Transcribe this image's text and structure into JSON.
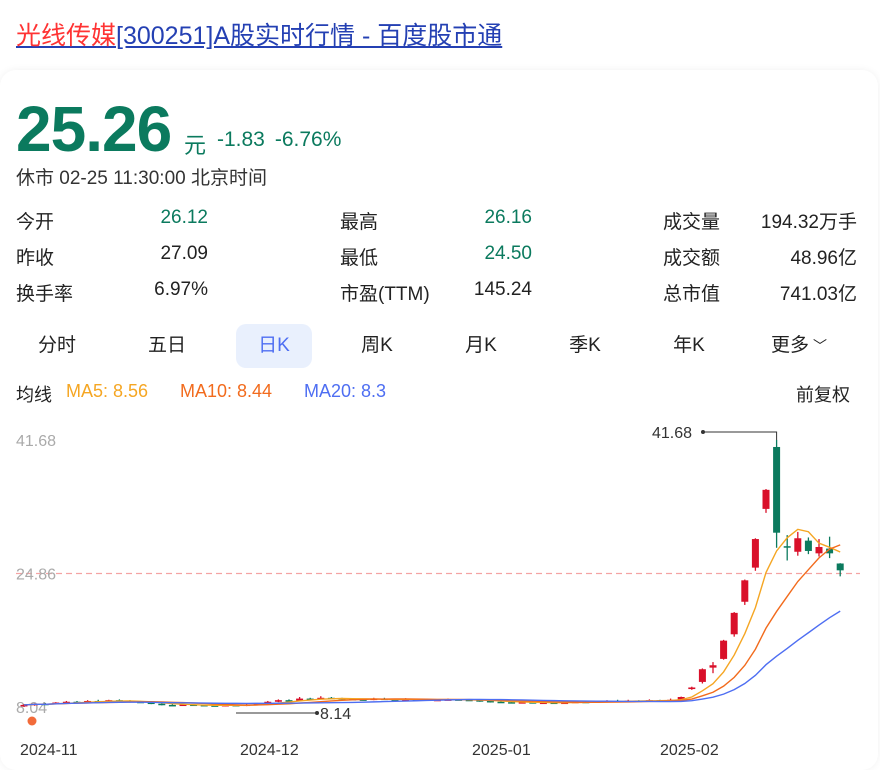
{
  "title": {
    "name": "光线传媒",
    "rest": "[300251]A股实时行情 - 百度股市通"
  },
  "quote": {
    "price": "25.26",
    "unit": "元",
    "change": "-1.83",
    "change_pct": "-6.76%",
    "status": "休市 02-25 11:30:00 北京时间"
  },
  "stats": [
    {
      "label": "今开",
      "value": "26.12",
      "green": true
    },
    {
      "label": "最高",
      "value": "26.16",
      "green": true
    },
    {
      "label": "成交量",
      "value": "194.32万手"
    },
    {
      "label": "昨收",
      "value": "27.09"
    },
    {
      "label": "最低",
      "value": "24.50",
      "green": true
    },
    {
      "label": "成交额",
      "value": "48.96亿"
    },
    {
      "label": "换手率",
      "value": "6.97%"
    },
    {
      "label": "市盈(TTM)",
      "value": "145.24"
    },
    {
      "label": "总市值",
      "value": "741.03亿"
    }
  ],
  "tabs": [
    {
      "label": "分时"
    },
    {
      "label": "五日"
    },
    {
      "label": "日K",
      "selected": true
    },
    {
      "label": "周K"
    },
    {
      "label": "月K"
    },
    {
      "label": "季K"
    },
    {
      "label": "年K"
    },
    {
      "label": "更多"
    }
  ],
  "legend": {
    "label": "均线",
    "ma5": "MA5: 8.56",
    "ma10": "MA10: 8.44",
    "ma20": "MA20: 8.3",
    "adjust": "前复权"
  },
  "colors": {
    "up": "#d9102a",
    "down": "#0b7a5e",
    "ma5": "#f5a623",
    "ma10": "#f26b1d",
    "ma20": "#4e6ef2",
    "link": "#2440b3",
    "accent": "#4e6ef2"
  },
  "chart_data": {
    "type": "candlestick",
    "y_ticks": [
      "41.68",
      "24.86",
      "8.04"
    ],
    "ref_line": 24.86,
    "max_label": "41.68",
    "min_label": "8.14",
    "x_labels": [
      "2024-11",
      "2024-12",
      "2025-01",
      "2025-02"
    ],
    "ylim": [
      8.04,
      41.68
    ],
    "ohlc_fields": [
      "open",
      "close",
      "high",
      "low"
    ],
    "candles": [
      [
        8.2,
        8.3,
        8.4,
        8.04
      ],
      [
        8.3,
        8.45,
        8.5,
        8.2
      ],
      [
        8.45,
        8.4,
        8.55,
        8.3
      ],
      [
        8.4,
        8.6,
        8.65,
        8.35
      ],
      [
        8.6,
        8.7,
        8.8,
        8.5
      ],
      [
        8.7,
        8.65,
        8.8,
        8.55
      ],
      [
        8.65,
        8.8,
        8.9,
        8.6
      ],
      [
        8.8,
        8.75,
        8.95,
        8.7
      ],
      [
        8.75,
        8.9,
        8.95,
        8.7
      ],
      [
        8.9,
        8.85,
        9.0,
        8.75
      ],
      [
        8.85,
        8.7,
        8.9,
        8.6
      ],
      [
        8.7,
        8.6,
        8.8,
        8.55
      ],
      [
        8.6,
        8.45,
        8.65,
        8.4
      ],
      [
        8.45,
        8.3,
        8.5,
        8.25
      ],
      [
        8.3,
        8.25,
        8.4,
        8.2
      ],
      [
        8.25,
        8.35,
        8.4,
        8.2
      ],
      [
        8.35,
        8.3,
        8.4,
        8.25
      ],
      [
        8.3,
        8.25,
        8.35,
        8.2
      ],
      [
        8.25,
        8.15,
        8.3,
        8.14
      ],
      [
        8.15,
        8.3,
        8.35,
        8.14
      ],
      [
        8.3,
        8.2,
        8.35,
        8.15
      ],
      [
        8.2,
        8.35,
        8.5,
        8.15
      ],
      [
        8.35,
        8.5,
        8.55,
        8.3
      ],
      [
        8.5,
        8.7,
        8.8,
        8.45
      ],
      [
        8.7,
        8.9,
        9.0,
        8.65
      ],
      [
        8.9,
        8.85,
        9.0,
        8.8
      ],
      [
        8.85,
        9.1,
        9.3,
        8.8
      ],
      [
        9.1,
        9.05,
        9.2,
        8.95
      ],
      [
        9.05,
        9.2,
        9.4,
        9.0
      ],
      [
        9.2,
        9.15,
        9.3,
        9.05
      ],
      [
        9.15,
        9.05,
        9.2,
        8.95
      ],
      [
        9.05,
        9.0,
        9.15,
        8.9
      ],
      [
        9.0,
        8.95,
        9.1,
        8.85
      ],
      [
        8.95,
        9.1,
        9.2,
        8.9
      ],
      [
        9.1,
        9.0,
        9.2,
        8.95
      ],
      [
        9.0,
        8.95,
        9.05,
        8.85
      ],
      [
        8.95,
        9.05,
        9.15,
        8.9
      ],
      [
        9.05,
        9.0,
        9.1,
        8.9
      ],
      [
        9.0,
        8.9,
        9.05,
        8.8
      ],
      [
        8.9,
        8.95,
        9.0,
        8.85
      ],
      [
        8.95,
        9.0,
        9.1,
        8.9
      ],
      [
        9.0,
        8.95,
        9.05,
        8.9
      ],
      [
        8.95,
        8.9,
        9.0,
        8.8
      ],
      [
        8.9,
        8.8,
        8.95,
        8.7
      ],
      [
        8.8,
        8.7,
        8.85,
        8.6
      ],
      [
        8.7,
        8.65,
        8.75,
        8.55
      ],
      [
        8.65,
        8.6,
        8.7,
        8.5
      ],
      [
        8.6,
        8.65,
        8.75,
        8.55
      ],
      [
        8.65,
        8.55,
        8.7,
        8.5
      ],
      [
        8.55,
        8.6,
        8.7,
        8.5
      ],
      [
        8.6,
        8.55,
        8.65,
        8.45
      ],
      [
        8.55,
        8.6,
        8.7,
        8.5
      ],
      [
        8.6,
        8.7,
        8.8,
        8.55
      ],
      [
        8.7,
        8.65,
        8.75,
        8.6
      ],
      [
        8.65,
        8.75,
        8.85,
        8.6
      ],
      [
        8.75,
        8.8,
        8.9,
        8.7
      ],
      [
        8.8,
        8.75,
        8.95,
        8.7
      ],
      [
        8.75,
        8.85,
        8.95,
        8.7
      ],
      [
        8.85,
        8.8,
        8.9,
        8.75
      ],
      [
        8.8,
        8.9,
        9.0,
        8.75
      ],
      [
        8.9,
        8.85,
        8.95,
        8.8
      ],
      [
        8.85,
        8.95,
        9.1,
        8.8
      ],
      [
        8.95,
        9.3,
        9.35,
        8.9
      ],
      [
        10.3,
        10.5,
        10.6,
        10.2
      ],
      [
        11.2,
        12.8,
        12.9,
        11.0
      ],
      [
        13.0,
        13.3,
        13.7,
        12.3
      ],
      [
        14.1,
        16.4,
        16.5,
        14.0
      ],
      [
        17.2,
        19.9,
        20.0,
        16.9
      ],
      [
        21.3,
        24.0,
        24.1,
        20.9
      ],
      [
        25.6,
        29.2,
        29.3,
        25.2
      ],
      [
        33.0,
        35.4,
        35.5,
        32.5
      ],
      [
        40.8,
        30.0,
        41.68,
        28.1
      ],
      [
        28.3,
        28.2,
        29.7,
        26.5
      ],
      [
        27.6,
        29.3,
        30.1,
        27.1
      ],
      [
        29.0,
        27.7,
        29.4,
        27.3
      ],
      [
        27.4,
        28.2,
        29.2,
        27.0
      ],
      [
        28.0,
        27.4,
        29.5,
        26.8
      ],
      [
        26.12,
        25.26,
        26.16,
        24.5
      ]
    ]
  }
}
